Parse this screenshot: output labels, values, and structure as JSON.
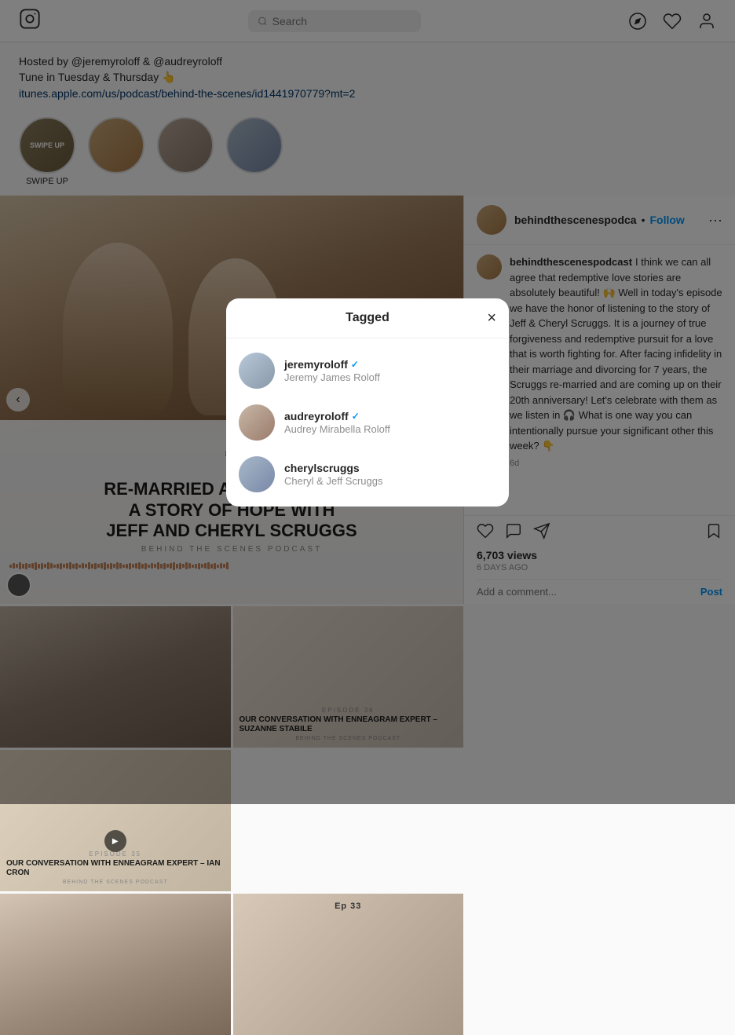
{
  "nav": {
    "search_placeholder": "Search",
    "logo_alt": "Instagram"
  },
  "profile_header": {
    "hosted_text": "Hosted by @jeremyroloff & @audreyroloff",
    "tune_text": "Tune in Tuesday & Thursday 👆",
    "apple_link": "itunes.apple.com/us/podcast/behind-the-scenes/id1441970779?mt=2"
  },
  "stories": [
    {
      "label": "SWIPE UP",
      "style": "s1"
    },
    {
      "label": "",
      "style": "s2"
    },
    {
      "label": "",
      "style": "s3"
    },
    {
      "label": "",
      "style": "s4"
    }
  ],
  "post": {
    "username": "behindthescenespodca",
    "follow_label": "Follow",
    "ep_label": "EP",
    "title": "RE-MARRIED AFTER DIVORCE\nA STORY OF HOPE WITH\nJEFF AND CHERYL SCRUGGS",
    "subtitle": "BEHIND THE SCENES PODCAST",
    "views": "6,703 views",
    "date": "6 DAYS AGO",
    "comment_placeholder": "Add a comment...",
    "post_label": "Post",
    "comment": {
      "username": "behindthescenespodcast",
      "text": "I think we can all agree that redemptive love stories are absolutely beautiful! 🙌 Well in today's episode we have the honor of listening to the story of Jeff & Cheryl Scruggs. It is a journey of true forgiveness and redemptive pursuit for a love that is worth fighting for. After facing infidelity in their marriage and divorcing for 7 years, the Scruggs re-married and are coming up on their 20th anniversary! Let's celebrate with them as we listen in 🎧 What is one way you can intentionally pursue your significant other this week? 👇",
      "time": "6d"
    }
  },
  "grid_items": [
    {
      "ep": "EPISODE 36",
      "title": "OUR CONVERSATION WITH ENNEAGRAM EXPERT – SUZANNE STABILE",
      "subtitle": "BEHIND THE SCENES PODCAST",
      "has_play": false
    },
    {
      "ep": "EPISODE 35",
      "title": "OUR CONVERSATION WITH ENNEAGRAM EXPERT – IAN CRON",
      "subtitle": "BEHIND THE SCENES PODCAST",
      "has_play": true
    }
  ],
  "grid_row2_items": [
    {
      "ep": "",
      "title": "",
      "subtitle": "",
      "has_play": false
    },
    {
      "ep": "Ep 33",
      "title": "",
      "subtitle": "",
      "has_play": false
    }
  ],
  "tagged_modal": {
    "title": "Tagged",
    "close_label": "×",
    "users": [
      {
        "username": "jeremyroloff",
        "verified": true,
        "fullname": "Jeremy James Roloff",
        "avatar_style": "avatar-1"
      },
      {
        "username": "audreyroloff",
        "verified": true,
        "fullname": "Audrey Mirabella Roloff",
        "avatar_style": "avatar-2"
      },
      {
        "username": "cherylscruggs",
        "verified": false,
        "fullname": "Cheryl & Jeff Scruggs",
        "avatar_style": "avatar-3"
      }
    ]
  }
}
